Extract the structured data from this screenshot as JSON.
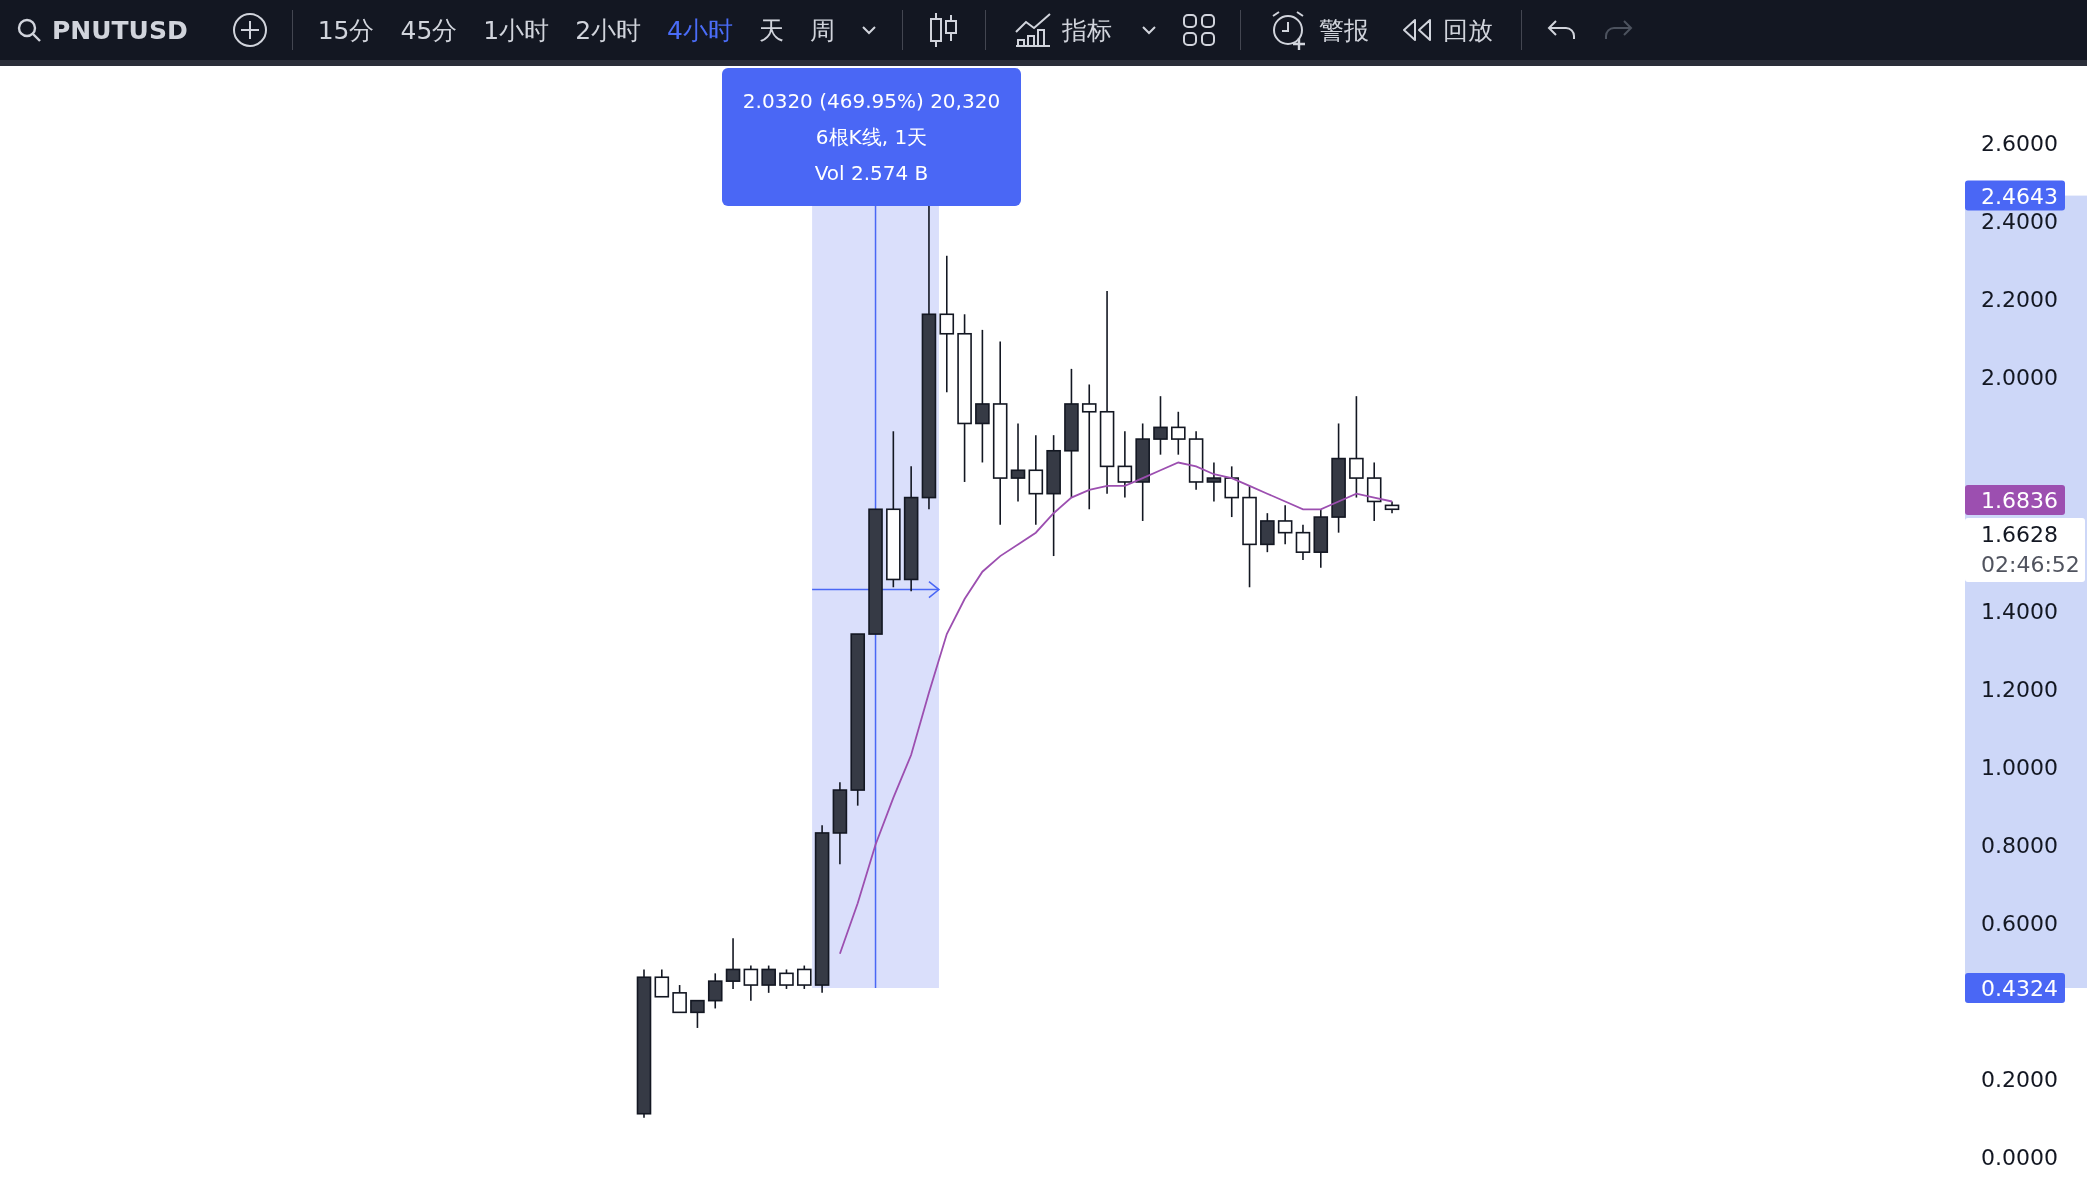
{
  "toolbar": {
    "symbol": "PNUTUSD",
    "intervals": [
      {
        "label": "15分",
        "selected": false
      },
      {
        "label": "45分",
        "selected": false
      },
      {
        "label": "1小时",
        "selected": false
      },
      {
        "label": "2小时",
        "selected": false
      },
      {
        "label": "4小时",
        "selected": true
      },
      {
        "label": "天",
        "selected": false
      },
      {
        "label": "周",
        "selected": false
      }
    ],
    "indicators_label": "指标",
    "alert_label": "警报",
    "replay_label": "回放",
    "undo_disabled": false,
    "redo_disabled": true
  },
  "measure": {
    "lines": [
      "2.0320 (469.95%) 20,320",
      "6根K线, 1天",
      "Vol 2.574 B"
    ]
  },
  "price_axis": {
    "labels": [
      "2.6000",
      "2.4000",
      "2.2000",
      "2.0000",
      "1.4000",
      "1.2000",
      "1.0000",
      "0.8000",
      "0.6000",
      "0.2000",
      "0.0000"
    ]
  },
  "price_labels": [
    {
      "kind": "range",
      "text": "2.4643",
      "color": "#4a67f5"
    },
    {
      "kind": "ma",
      "text": "1.6836",
      "color": "#9c4fb0"
    },
    {
      "kind": "last",
      "text": "1.6628",
      "countdown": "02:46:52"
    },
    {
      "kind": "range",
      "text": "0.4324",
      "color": "#4a67f5"
    }
  ]
}
